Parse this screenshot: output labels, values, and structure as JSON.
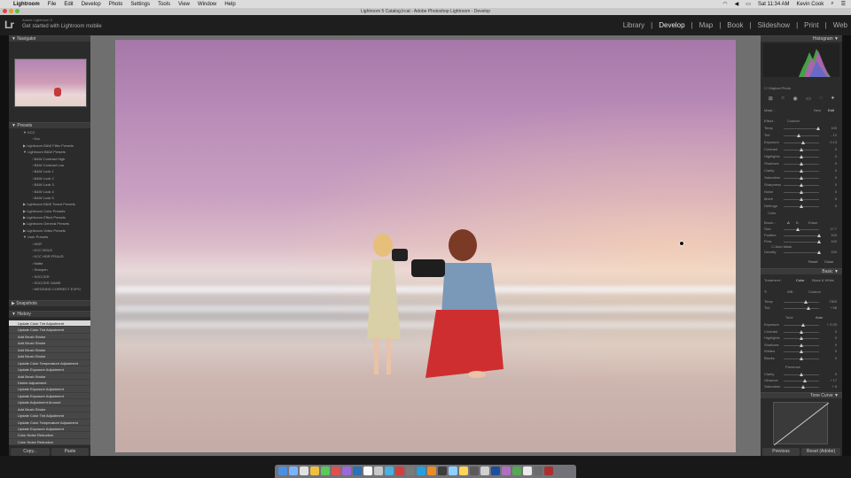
{
  "menubar": {
    "app": "Lightroom",
    "items": [
      "File",
      "Edit",
      "Develop",
      "Photo",
      "Settings",
      "Tools",
      "View",
      "Window",
      "Help"
    ],
    "time": "Sat 11:34 AM",
    "user": "Kevin Cook"
  },
  "window": {
    "title": "Lightroom 5 Catalog.lrcat - Adobe Photoshop Lightroom - Develop"
  },
  "header": {
    "logo": "Lr",
    "line1": "Adobe Lightroom 5",
    "line2": "Get started with Lightroom mobile",
    "modules": [
      "Library",
      "Develop",
      "Map",
      "Book",
      "Slideshow",
      "Print",
      "Web"
    ],
    "active": "Develop"
  },
  "left": {
    "navigator": "Navigator",
    "presets_title": "Presets",
    "presets": [
      {
        "label": "KCC",
        "level": 1,
        "open": true
      },
      {
        "label": "Kcc",
        "level": 2
      },
      {
        "label": "Lightroom B&W Filter Presets",
        "level": 1
      },
      {
        "label": "Lightroom B&W Presets",
        "level": 1,
        "open": true
      },
      {
        "label": "B&W Contrast High",
        "level": 2
      },
      {
        "label": "B&W Contrast Low",
        "level": 2
      },
      {
        "label": "B&W Look 1",
        "level": 2
      },
      {
        "label": "B&W Look 2",
        "level": 2
      },
      {
        "label": "B&W Look 3",
        "level": 2
      },
      {
        "label": "B&W Look 4",
        "level": 2
      },
      {
        "label": "B&W Look 5",
        "level": 2
      },
      {
        "label": "Lightroom B&W Toned Presets",
        "level": 1
      },
      {
        "label": "Lightroom Color Presets",
        "level": 1
      },
      {
        "label": "Lightroom Effect Presets",
        "level": 1
      },
      {
        "label": "Lightroom General Presets",
        "level": 1
      },
      {
        "label": "Lightroom Video Presets",
        "level": 1
      },
      {
        "label": "User Presets",
        "level": 1,
        "open": true
      },
      {
        "label": "HDR",
        "level": 2
      },
      {
        "label": "KCC BOLD",
        "level": 2
      },
      {
        "label": "KCC HDR FRAUD",
        "level": 2
      },
      {
        "label": "Matte",
        "level": 2
      },
      {
        "label": "Sharpen",
        "level": 2
      },
      {
        "label": "SOCCER",
        "level": 2
      },
      {
        "label": "SOCCER GAME",
        "level": 2
      },
      {
        "label": "WEDDING CORRECT EXPO",
        "level": 2
      }
    ],
    "snapshots": "Snapshots",
    "history_title": "History",
    "history": [
      "Update Color Tint Adjustment",
      "Update Color Tint Adjustment",
      "Add Brush Stroke",
      "Add Brush Stroke",
      "Add Brush Stroke",
      "Add Brush Stroke",
      "Update Color Temperature Adjustment",
      "Update Exposure Adjustment",
      "Add Brush Stroke",
      "Delete Adjustment",
      "Update Exposure Adjustment",
      "Update Exposure Adjustment",
      "Update Adjustment Amount",
      "Add Brush Stroke",
      "Update Color Tint Adjustment",
      "Update Color Temperature Adjustment",
      "Update Exposure Adjustment",
      "Color Noise Reduction",
      "Color Noise Reduction"
    ],
    "copy": "Copy...",
    "paste": "Paste"
  },
  "right": {
    "histogram": "Histogram",
    "original": "Original Photo",
    "mask": {
      "label": "Mask :",
      "new": "New",
      "edit": "Edit",
      "effect": "Effect :",
      "effect_val": "Custom"
    },
    "sliders1": [
      {
        "label": "Temp",
        "value": "100",
        "pos": 0.98
      },
      {
        "label": "Tint",
        "value": "- 12",
        "pos": 0.42
      },
      {
        "label": "Exposure",
        "value": "0.13",
        "pos": 0.55
      },
      {
        "label": "Contrast",
        "value": "0",
        "pos": 0.5
      },
      {
        "label": "Highlights",
        "value": "0",
        "pos": 0.5
      },
      {
        "label": "Shadows",
        "value": "0",
        "pos": 0.5
      },
      {
        "label": "Clarity",
        "value": "0",
        "pos": 0.5
      },
      {
        "label": "Saturation",
        "value": "0",
        "pos": 0.5
      },
      {
        "label": "Sharpness",
        "value": "0",
        "pos": 0.5
      },
      {
        "label": "Noise",
        "value": "0",
        "pos": 0.5
      },
      {
        "label": "Moiré",
        "value": "0",
        "pos": 0.5
      },
      {
        "label": "Defringe",
        "value": "0",
        "pos": 0.5
      }
    ],
    "color": "Color",
    "brush": {
      "label": "Brush :",
      "a": "A",
      "b": "B",
      "erase": "Erase"
    },
    "brush_sliders": [
      {
        "label": "Size",
        "value": "17.7",
        "pos": 0.4
      },
      {
        "label": "Feather",
        "value": "100",
        "pos": 1
      },
      {
        "label": "Flow",
        "value": "100",
        "pos": 1
      }
    ],
    "automask": "Auto Mask",
    "density": {
      "label": "Density",
      "value": "100"
    },
    "reset": "Reset",
    "close": "Close",
    "basic": "Basic",
    "treatment": {
      "label": "Treatment :",
      "color": "Color",
      "bw": "Black & White"
    },
    "wb": {
      "label": "WB :",
      "value": "Custom"
    },
    "wb_sliders": [
      {
        "label": "Temp",
        "value": "7300",
        "pos": 0.62
      },
      {
        "label": "Tint",
        "value": "+ 58",
        "pos": 0.7
      }
    ],
    "tone": "Tone",
    "auto": "Auto",
    "tone_sliders": [
      {
        "label": "Exposure",
        "value": "+ 0.33",
        "pos": 0.56
      },
      {
        "label": "Contrast",
        "value": "0",
        "pos": 0.5
      },
      {
        "label": "Highlights",
        "value": "0",
        "pos": 0.5
      },
      {
        "label": "Shadows",
        "value": "0",
        "pos": 0.5
      },
      {
        "label": "Whites",
        "value": "0",
        "pos": 0.5
      },
      {
        "label": "Blacks",
        "value": "0",
        "pos": 0.5
      }
    ],
    "presence": "Presence",
    "presence_sliders": [
      {
        "label": "Clarity",
        "value": "0",
        "pos": 0.5
      },
      {
        "label": "Vibrance",
        "value": "+ 17",
        "pos": 0.6
      },
      {
        "label": "Saturation",
        "value": "+ 8",
        "pos": 0.55
      }
    ],
    "tone_curve": "Tone Curve",
    "previous": "Previous",
    "reset_adobe": "Reset (Adobe)"
  }
}
